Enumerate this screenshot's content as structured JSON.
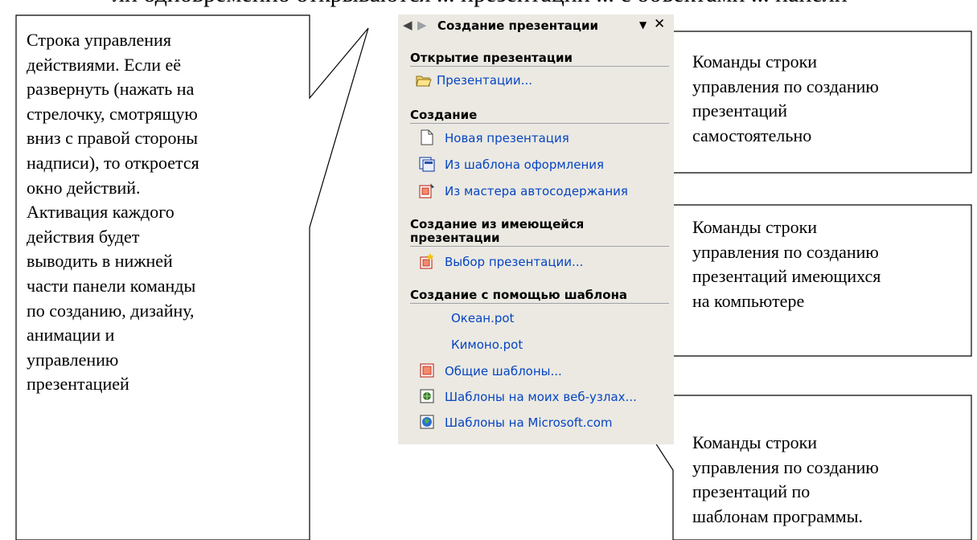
{
  "top_text": "ли одновременно открываются ... презентации ... с объектами ... панели",
  "left_callout": {
    "lines": [
      "Строка управления",
      "действиями. Если её",
      "развернуть (нажать на",
      "стрелочку, смотрящую",
      "вниз с правой стороны",
      "надписи), то откроется",
      "окно действий.",
      "Активация каждого",
      "действия будет",
      "выводить в нижней",
      "части панели команды",
      "по созданию, дизайну,",
      "анимации и",
      "управлению",
      "презентацией"
    ]
  },
  "right_callouts": [
    {
      "lines": [
        "Команды строки",
        "управления по созданию",
        "презентаций",
        "самостоятельно"
      ]
    },
    {
      "lines": [
        "Команды строки",
        "управления по созданию",
        "презентаций имеющихся",
        "на компьютере"
      ]
    },
    {
      "lines": [
        "Команды строки",
        "управления по созданию",
        "презентаций по",
        "шаблонам программы."
      ]
    }
  ],
  "panel": {
    "title": "Создание презентации",
    "icons": [
      "back-arrow-icon",
      "forward-arrow-icon",
      "dropdown-arrow-icon",
      "close-icon"
    ],
    "sections": [
      {
        "title": "Открытие презентации",
        "items": [
          {
            "label": "Презентации...",
            "icon": "open-folder-icon"
          }
        ]
      },
      {
        "title": "Создание",
        "items": [
          {
            "label": "Новая презентация",
            "icon": "blank-page-icon"
          },
          {
            "label": "Из шаблона оформления",
            "icon": "design-template-icon"
          },
          {
            "label": "Из мастера автосодержания",
            "icon": "autocontent-wizard-icon"
          }
        ]
      },
      {
        "title_line1": "Создание из имеющейся",
        "title_line2": "презентации",
        "items": [
          {
            "label": "Выбор презентации...",
            "icon": "existing-presentation-icon"
          }
        ]
      },
      {
        "title": "Создание с помощью шаблона",
        "items": [
          {
            "label": "Океан.pot"
          },
          {
            "label": "Кимоно.pot"
          },
          {
            "label": "Общие шаблоны...",
            "icon": "general-templates-icon"
          },
          {
            "label": "Шаблоны на моих веб-узлах...",
            "icon": "web-templates-icon"
          },
          {
            "label": "Шаблоны на Microsoft.com",
            "icon": "microsoft-templates-icon"
          }
        ]
      }
    ]
  }
}
